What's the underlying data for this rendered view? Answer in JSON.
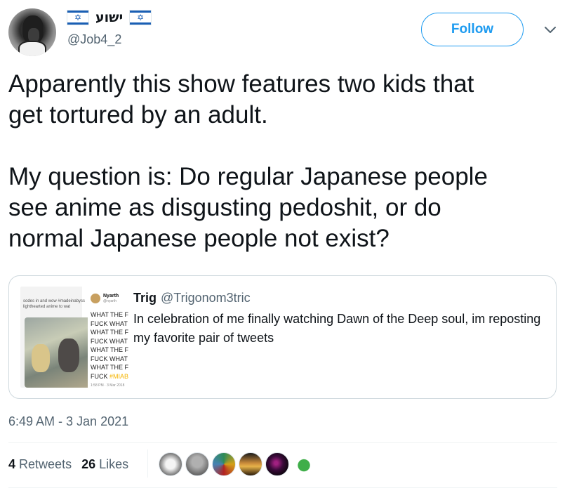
{
  "author": {
    "display_name": "ישוע",
    "handle": "@Job4_2",
    "flag_icon": "israel-flag-icon"
  },
  "actions": {
    "follow_label": "Follow",
    "more_icon": "chevron-down-icon"
  },
  "tweet": {
    "text": "Apparently this show features two kids that\nget tortured by an adult.\n\nMy question is: Do regular Japanese people\nsee anime as disgusting pedoshit, or do\nnormal Japanese people not exist?"
  },
  "quoted_tweet": {
    "name": "Trig",
    "handle": "@Trigonom3tric",
    "text": "In celebration of me finally watching Dawn of the Deep soul, im reposting my favorite pair of tweets",
    "thumbnail": {
      "left_line1": "sodes in and wow #madeinabyss",
      "left_line2": "lighthearted anime to wat",
      "left_line3": "^^",
      "author_name": "Nyarth",
      "author_handle": "@nyarth",
      "lines": [
        "WHAT THE F",
        "FUCK WHAT",
        "WHAT THE F",
        "FUCK WHAT",
        "WHAT THE F",
        "FUCK WHAT",
        "WHAT THE F"
      ],
      "last_line": "FUCK",
      "hashtag": "#MIAB",
      "time": "1:58 PM · 3 Mar 2018"
    }
  },
  "meta": {
    "timestamp": "6:49 AM - 3 Jan 2021",
    "retweets_count": "4",
    "retweets_label": "Retweets",
    "likes_count": "26",
    "likes_label": "Likes"
  },
  "colors": {
    "accent": "#1d9bf0",
    "text": "#0f1419",
    "muted": "#536471",
    "border": "#cfd9de"
  }
}
